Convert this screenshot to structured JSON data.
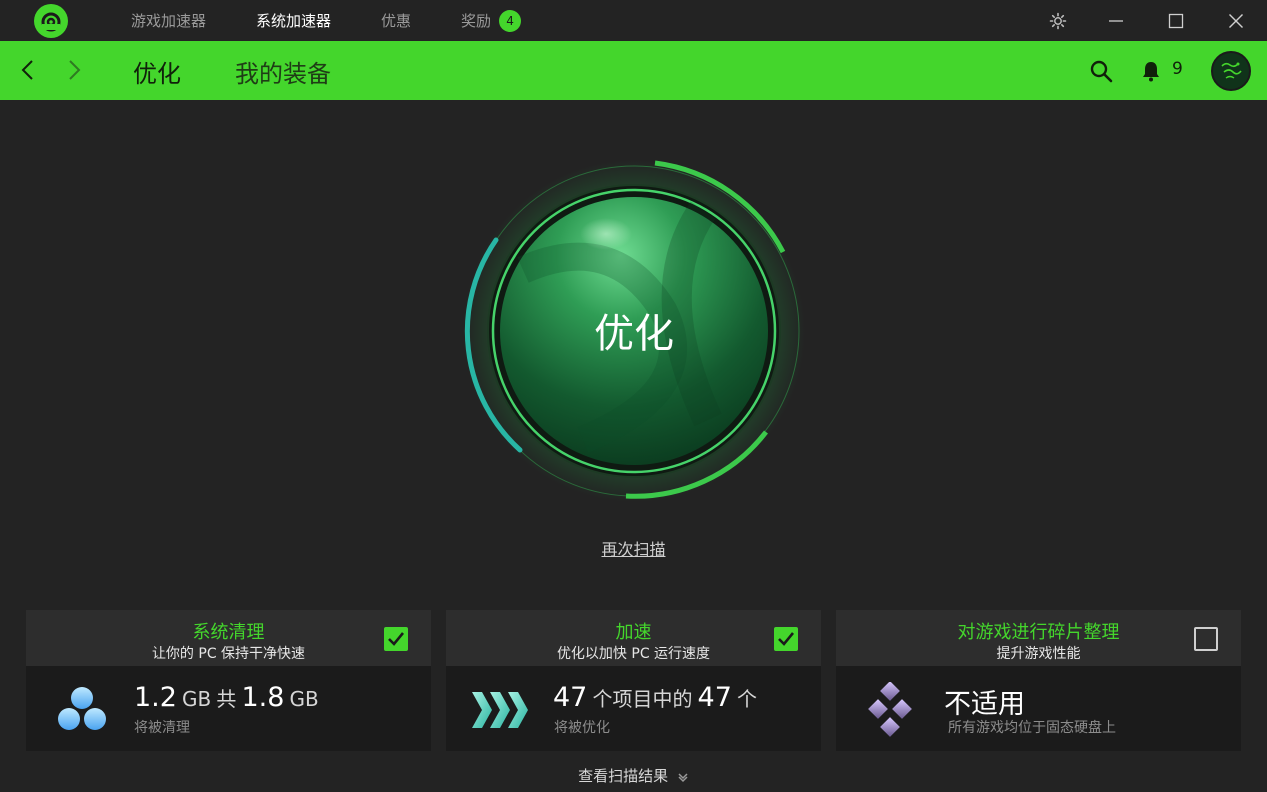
{
  "titlebar": {
    "tabs": [
      {
        "label": "游戏加速器"
      },
      {
        "label": "系统加速器"
      },
      {
        "label": "优惠"
      },
      {
        "label": "奖励"
      }
    ],
    "rewards_badge": "4"
  },
  "navbar": {
    "tabs": [
      {
        "label": "优化"
      },
      {
        "label": "我的装备"
      }
    ],
    "notification_count": "9"
  },
  "orb": {
    "label": "优化",
    "rescan_link": "再次扫描"
  },
  "cards": [
    {
      "title": "系统清理",
      "subtitle": "让你的 PC 保持干净快速",
      "checked": true,
      "value1": "1.2",
      "unit1": "GB",
      "joiner": "共",
      "value2": "1.8",
      "unit2": "GB",
      "note": "将被清理"
    },
    {
      "title": "加速",
      "subtitle": "优化以加快 PC 运行速度",
      "checked": true,
      "value1": "47",
      "mid": "个项目中的",
      "value2": "47",
      "suffix": "个",
      "note": "将被优化"
    },
    {
      "title": "对游戏进行碎片整理",
      "subtitle": "提升游戏性能",
      "checked": false,
      "status": "不适用",
      "note": "所有游戏均位于固态硬盘上"
    }
  ],
  "footer": {
    "results_link": "查看扫描结果"
  },
  "colors": {
    "accent": "#44d62c",
    "background": "#232323",
    "card_header": "#2d2d2d",
    "card_body": "#1b1b1b"
  }
}
